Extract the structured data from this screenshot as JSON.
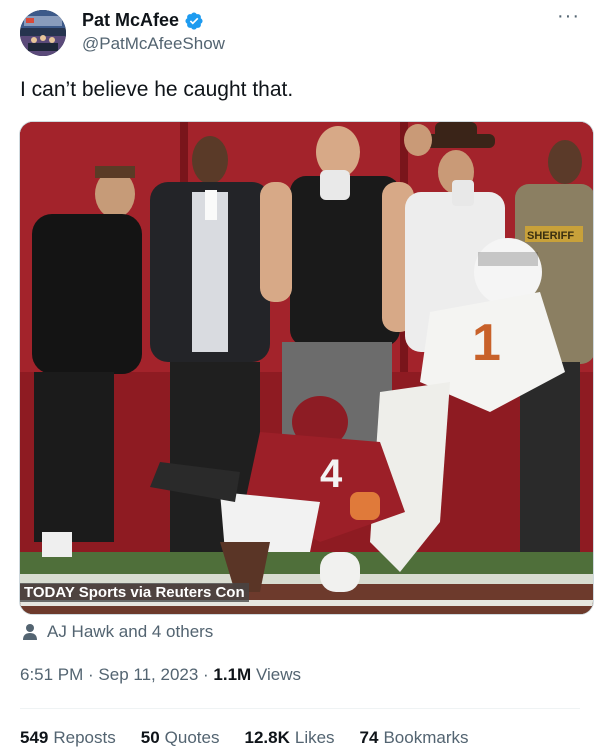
{
  "author": {
    "name": "Pat McAfee",
    "handle": "@PatMcAfeeShow"
  },
  "tweet": {
    "text": "I can’t believe he caught that."
  },
  "media": {
    "credit": "TODAY Sports via Reuters Con",
    "jersey_text_back": "4",
    "jersey_text_front": "1",
    "mic_label": "",
    "shirt_badge": "SHERIFF"
  },
  "tagged": {
    "text": "AJ Hawk and 4 others"
  },
  "meta": {
    "time": "6:51 PM",
    "separator": " · ",
    "date": "Sep 11, 2023",
    "views_count": "1.1M",
    "views_label": " Views"
  },
  "stats": {
    "reposts_count": "549",
    "reposts_label": "Reposts",
    "quotes_count": "50",
    "quotes_label": "Quotes",
    "likes_count": "12.8K",
    "likes_label": "Likes",
    "bookmarks_count": "74",
    "bookmarks_label": "Bookmarks"
  },
  "colors": {
    "verified_blue": "#1d9bf0",
    "text_primary": "#0f1419",
    "text_secondary": "#536471"
  },
  "icons": {
    "verified": "verified-badge-icon",
    "more": "more-icon",
    "tagged": "person-icon"
  }
}
